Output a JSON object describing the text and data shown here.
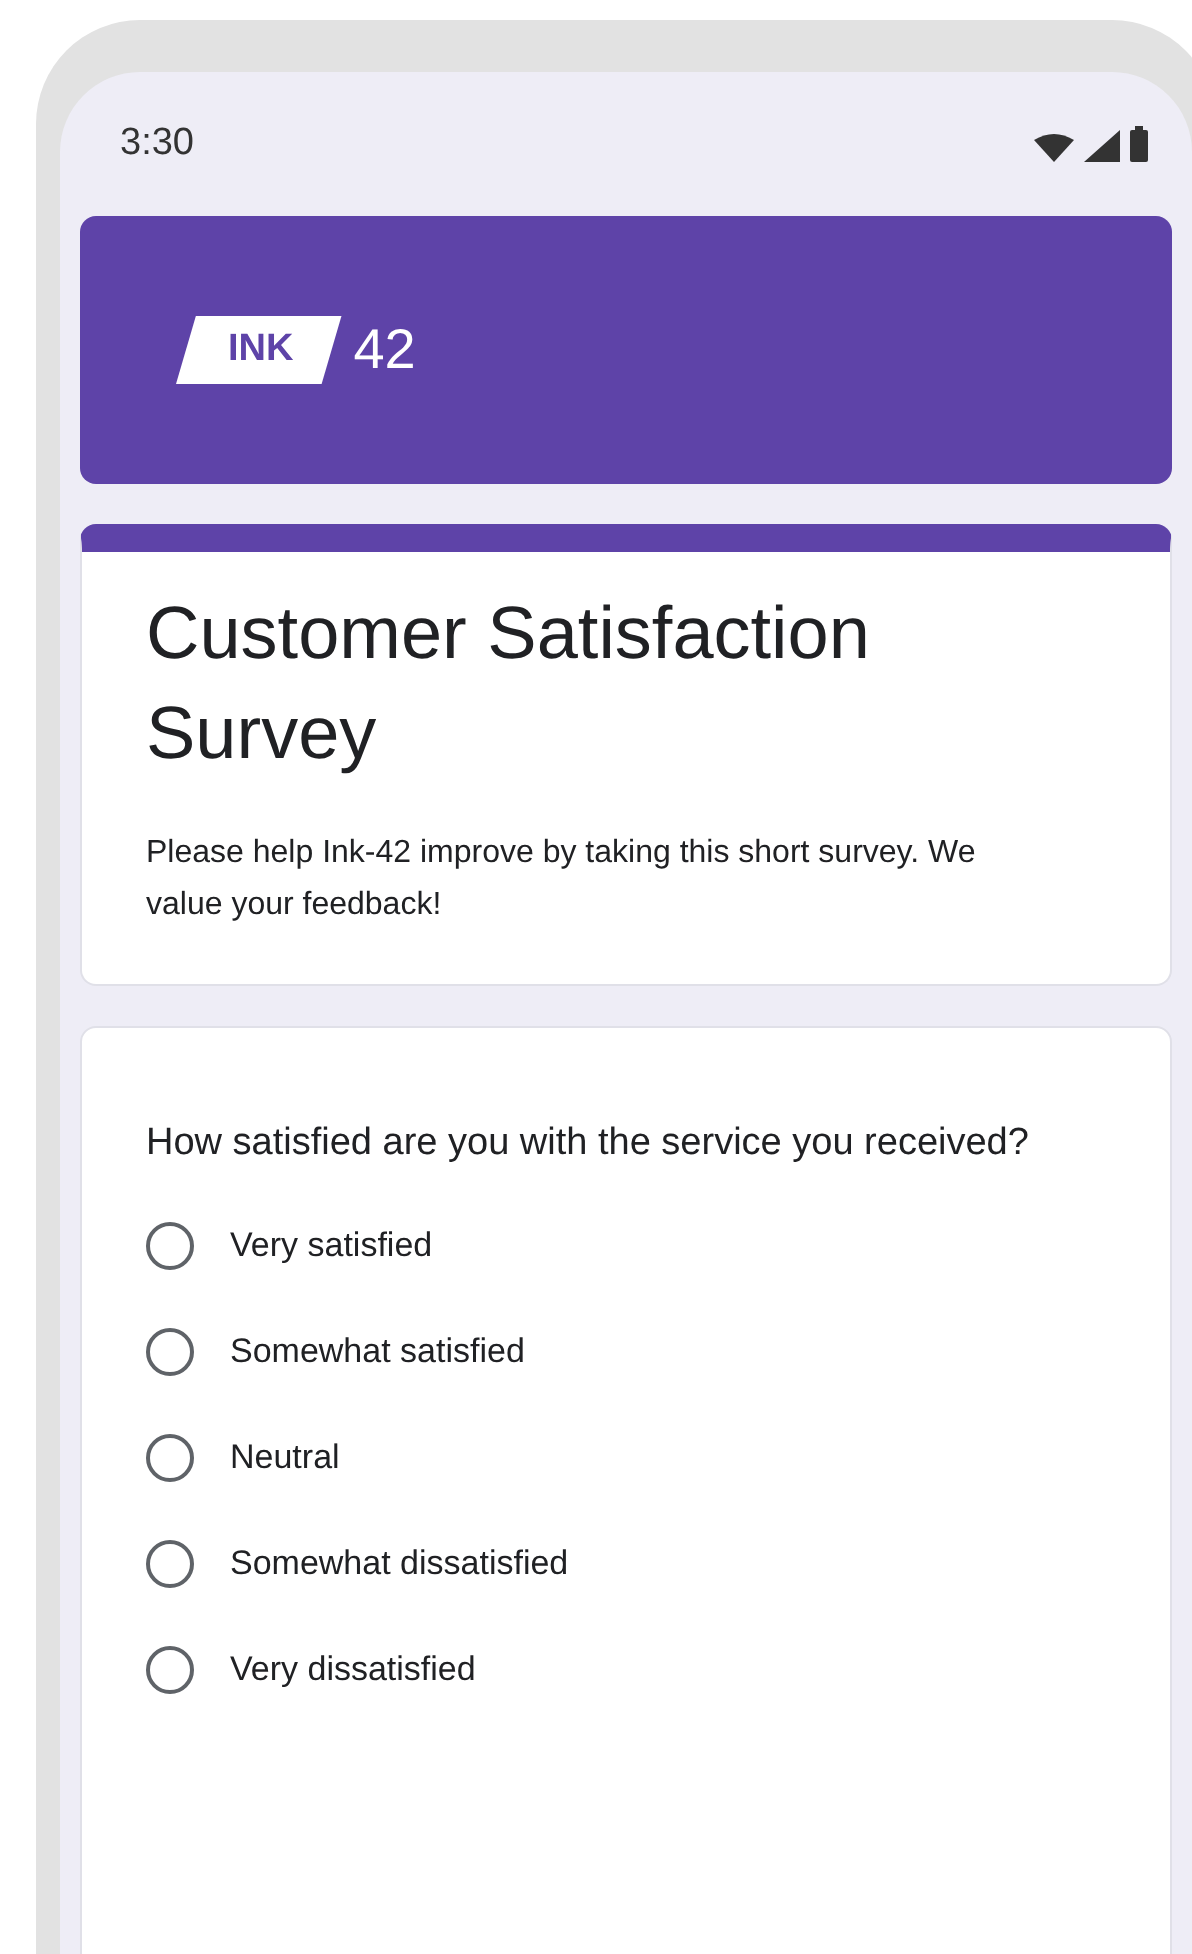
{
  "status_bar": {
    "time": "3:30"
  },
  "header": {
    "logo_badge": "INK",
    "logo_text": "42"
  },
  "form": {
    "title": "Customer Satisfaction Survey",
    "description": "Please help Ink-42 improve by taking this short survey. We value your feedback!"
  },
  "question": {
    "text": "How satisfied are you with the service you received?",
    "options": [
      {
        "label": "Very satisfied",
        "selected": false
      },
      {
        "label": "Somewhat satisfied",
        "selected": false
      },
      {
        "label": "Neutral",
        "selected": false
      },
      {
        "label": "Somewhat dissatisfied",
        "selected": false
      },
      {
        "label": "Very dissatisfied",
        "selected": false
      }
    ]
  }
}
